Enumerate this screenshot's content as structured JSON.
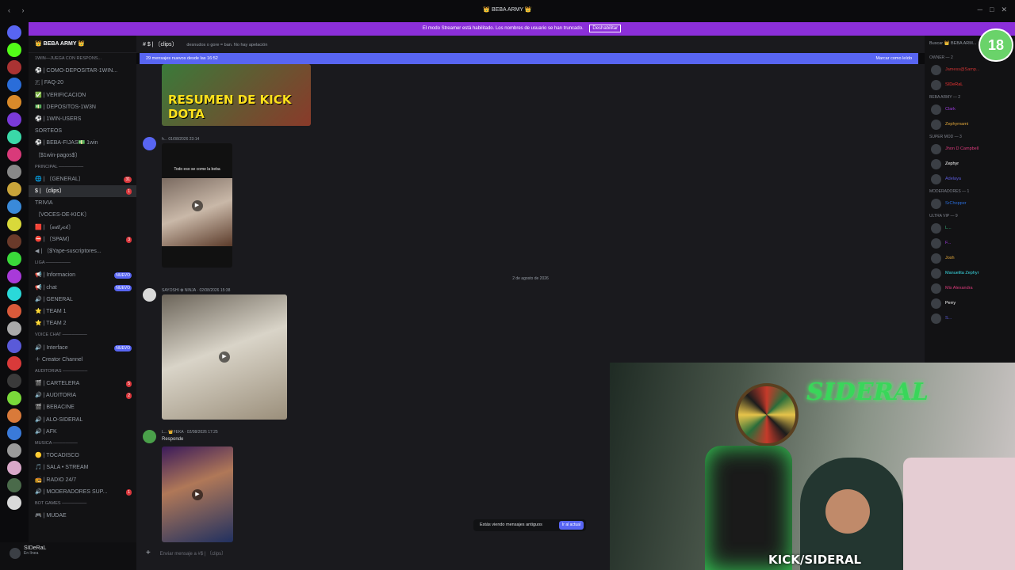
{
  "titlebar": {
    "title": "👑 BEBA ARMY 👑"
  },
  "banner": {
    "text": "El modo Streamer está habilitado. Los nombres de usuario se han truncado.",
    "button": "Deshabilitar"
  },
  "server": {
    "name": "👑 BEBA ARMY 👑"
  },
  "channels": [
    {
      "label": "1WIN—JUEGA CON RESPONS...",
      "type": "cat"
    },
    {
      "label": "⚽ | COMO-DEPOSITAR-1WIN..."
    },
    {
      "label": "🇫 | FAQ-20"
    },
    {
      "label": "✅ | VERIFICACION"
    },
    {
      "label": "💵 | DEPOSITOS-1W3N"
    },
    {
      "label": "⚽ | 1WIN-USERS"
    },
    {
      "label": "SORTEOS"
    },
    {
      "label": "⚽ | BEBA-FIJAS💵 1win"
    },
    {
      "label": "〔$1win-pagos$〕"
    },
    {
      "label": "PRINCIPAL ────────",
      "type": "cat"
    },
    {
      "label": "🌐 | 〔GENERAL〕",
      "badge": "31"
    },
    {
      "label": "$ | 〔clips〕",
      "badge": "1",
      "active": true
    },
    {
      "label": "TRIVIA"
    },
    {
      "label": "〔VOCES-DE-KICK〕"
    },
    {
      "label": "🟥 | 〔𝒶𝒹𝒷𝒿𝒸𝓀〕"
    },
    {
      "label": "⛔ | 〔SPAM〕",
      "badge": "3"
    },
    {
      "label": "◀ | 〔$Yape-suscriptores..."
    },
    {
      "label": "LIGA ────────",
      "type": "cat"
    },
    {
      "label": "📢 | Informacion",
      "new": "NUEVO"
    },
    {
      "label": "📢 | chat",
      "new": "NUEVO"
    },
    {
      "label": "🔊 | GENERAL"
    },
    {
      "label": "⭐ | TEAM 1"
    },
    {
      "label": "⭐ | TEAM 2"
    },
    {
      "label": "VOICE CHAT ────────",
      "type": "cat"
    },
    {
      "label": "🔊 | Interface",
      "new": "NUEVO"
    },
    {
      "label": "＋ Creator Channel"
    },
    {
      "label": "AUDITORIAS ────────",
      "type": "cat"
    },
    {
      "label": "🎬 | CARTELERA",
      "badge": "5"
    },
    {
      "label": "🔊 | AUDITORIA",
      "badge": "2"
    },
    {
      "label": "🎬 | BEBACINE"
    },
    {
      "label": "🔊 | ALO-SIDERAL"
    },
    {
      "label": "🔊 | AFK"
    },
    {
      "label": "MUSICA ────────",
      "type": "cat"
    },
    {
      "label": "🟡 | TOCADISCO"
    },
    {
      "label": "🎵 | SALA • STREAM"
    },
    {
      "label": "📻 | RADIO 24/7"
    },
    {
      "label": "🔊 | MODERADORES SUP...",
      "badge": "1"
    },
    {
      "label": "BOT GAMES ────────",
      "type": "cat"
    },
    {
      "label": "🎮 | MUDAE"
    }
  ],
  "user": {
    "name": "SIDeRaL",
    "status": "En línea"
  },
  "channel_header": {
    "name": "$ | 〔clips〕",
    "topic": "desnudos o gore = ban. No hay apelación"
  },
  "new_messages": {
    "text": "29 mensajes nuevos desde las 16:52",
    "mark": "Marcar como leído"
  },
  "messages": [
    {
      "meta": "h... 01/08/2026 23:14",
      "caption": "Todo eso se come la beba"
    },
    {
      "meta": "SAYOSHI ✿ NINJA · 02/08/2026 15:38"
    },
    {
      "meta": "L... 👑FEKA · 02/08/2026 17:25",
      "reply": "Responde"
    }
  ],
  "thumb_text": "RESUMEN DE KICK DOTA",
  "date_separator": "2 de agosto de 2026",
  "old_messages": {
    "text": "Estás viendo mensajes antiguos",
    "button": "Ir al actual"
  },
  "composer": {
    "placeholder": "Enviar mensaje a #$ | 〔clips〕"
  },
  "members": {
    "search": "Buscar 👑 BEBA ARM...",
    "groups": [
      {
        "title": "OWNER — 2",
        "items": [
          "Jamess@Samp...",
          "SIDeRaL"
        ]
      },
      {
        "title": "BEBA ARMY — 2",
        "items": [
          "Clark",
          "Zephyrnami"
        ]
      },
      {
        "title": "SUPER MOD — 3",
        "items": [
          "Jhon D Campbell",
          "Zephyr",
          "Adelaya"
        ]
      },
      {
        "title": "MODERADORES — 1",
        "items": [
          "SrChopper"
        ]
      },
      {
        "title": "ULTRA VIP — 9",
        "items": [
          "L...",
          "F...",
          "Josh",
          "Manuelita Zephyr",
          "Mis Alexandra",
          "Perry",
          "S..."
        ]
      }
    ]
  },
  "age_badge": "18",
  "webcam": {
    "sign": "SIDERAL",
    "watermark": "KICK/SIDERAL"
  }
}
